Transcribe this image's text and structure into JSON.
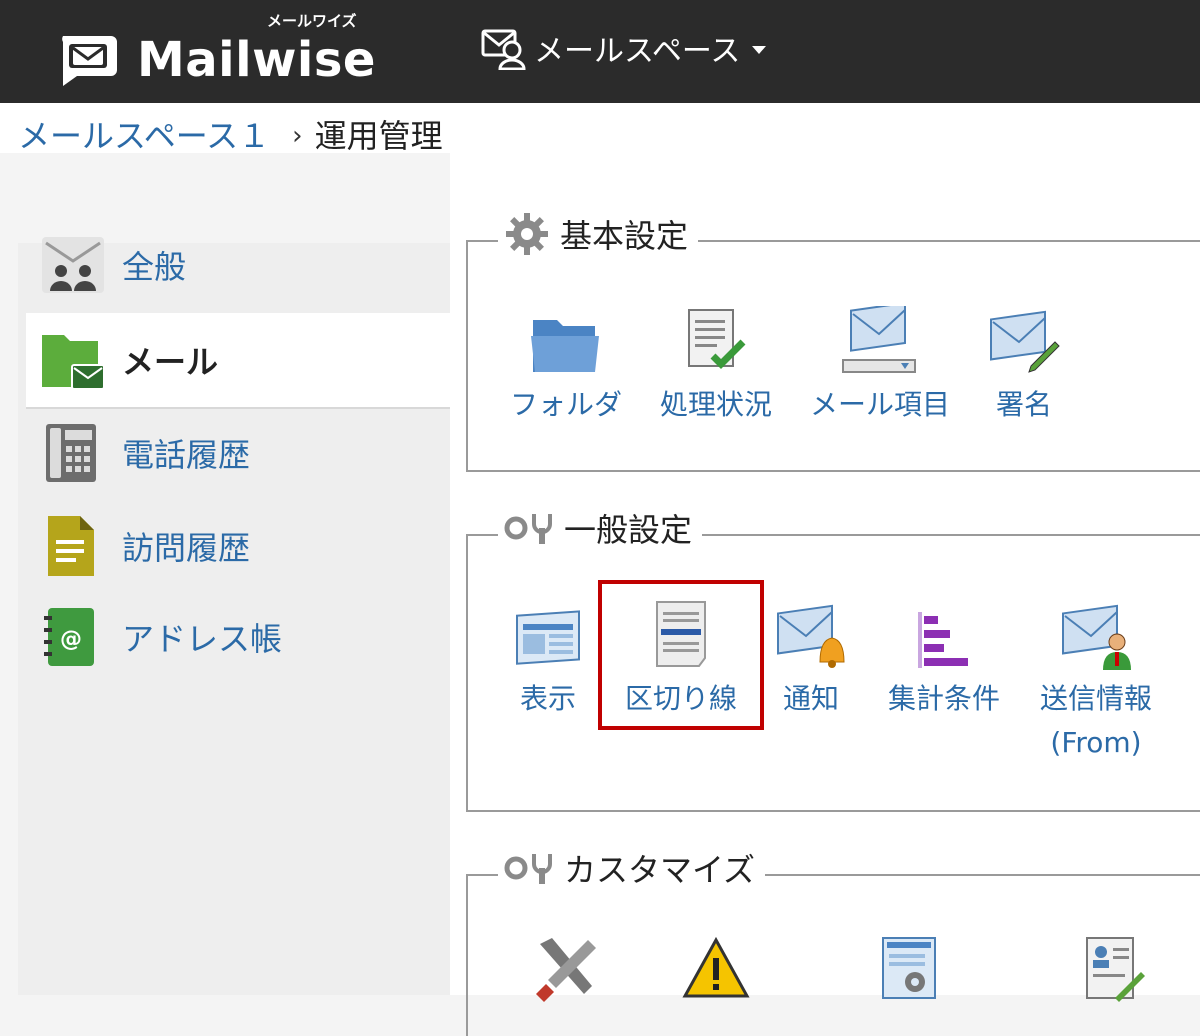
{
  "header": {
    "logo_text": "Mailwise",
    "logo_subtext": "メールワイズ",
    "space_menu_label": "メールスペース"
  },
  "breadcrumb": {
    "parent": "メールスペース１",
    "separator": "›",
    "current": "運用管理"
  },
  "sidebar": {
    "items": [
      {
        "label": "全般",
        "icon": "general-users-icon"
      },
      {
        "label": "メール",
        "icon": "mail-folder-icon",
        "active": true
      },
      {
        "label": "電話履歴",
        "icon": "phone-icon"
      },
      {
        "label": "訪問履歴",
        "icon": "visit-document-icon"
      },
      {
        "label": "アドレス帳",
        "icon": "address-book-icon"
      }
    ]
  },
  "sections": {
    "basic": {
      "title": "基本設定",
      "items": [
        {
          "label": "フォルダ",
          "icon": "folder-icon"
        },
        {
          "label": "処理状況",
          "icon": "status-checklist-icon"
        },
        {
          "label": "メール項目",
          "icon": "mail-fields-icon"
        },
        {
          "label": "署名",
          "icon": "signature-icon"
        }
      ]
    },
    "general": {
      "title": "一般設定",
      "items": [
        {
          "label": "表示",
          "icon": "display-icon"
        },
        {
          "label": "区切り線",
          "icon": "separator-line-icon"
        },
        {
          "label": "通知",
          "icon": "notification-bell-icon"
        },
        {
          "label": "集計条件",
          "icon": "aggregate-chart-icon"
        },
        {
          "label": "送信情報",
          "label2": "(From)",
          "icon": "sender-info-icon"
        }
      ]
    },
    "custom": {
      "title": "カスタマイズ"
    }
  },
  "colors": {
    "topbar": "#2b2b2b",
    "link": "#2b6aa7",
    "highlight": "#c00000"
  }
}
